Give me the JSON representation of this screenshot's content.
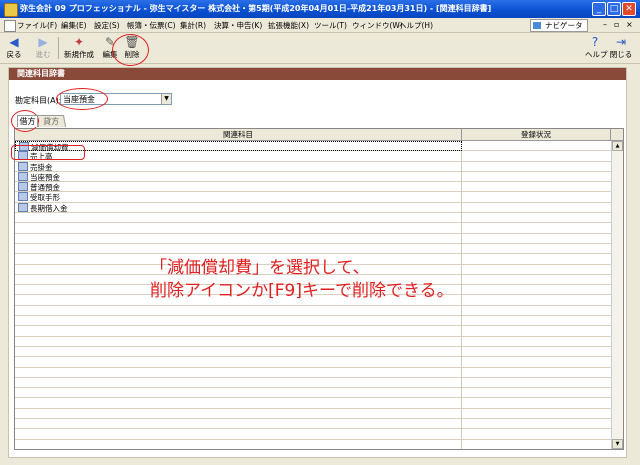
{
  "window": {
    "title": "弥生会計 09 プロフェッショナル - 弥生マイスター 株式会社・第5期(平成20年04月01日-平成21年03月31日) - [関連科目辞書]"
  },
  "menu": {
    "items": [
      "ファイル(F)",
      "編集(E)",
      "設定(S)",
      "帳簿・伝票(C)",
      "集計(R)",
      "決算・申告(K)",
      "拡張機能(X)",
      "ツール(T)",
      "ウィンドウ(W)",
      "ヘルプ(H)"
    ],
    "navi_label": "ナビゲータ"
  },
  "toolbar": {
    "back": "戻る",
    "forward": "進む",
    "new": "新規作成",
    "edit": "編集",
    "delete": "削除",
    "help": "ヘルプ",
    "close": "閉じる"
  },
  "panel": {
    "header": "関連科目辞書",
    "kamoku_label": "勘定科目(A):",
    "kamoku_value": "当座預金",
    "tabs": [
      "借方",
      "貸方"
    ],
    "columns": [
      "関連科目",
      "登録状況"
    ],
    "rows": [
      "減価償却費",
      "売上高",
      "売掛金",
      "当座預金",
      "普通預金",
      "受取手形",
      "長期借入金"
    ]
  },
  "annotation": {
    "line1": "「減価償却費」を選択して、",
    "line2": "削除アイコンか[F9]キーで削除できる。"
  },
  "colors": {
    "annotation": "#e02020",
    "titlebar": "#0a4fd0",
    "panel_header": "#8a4a3a"
  }
}
